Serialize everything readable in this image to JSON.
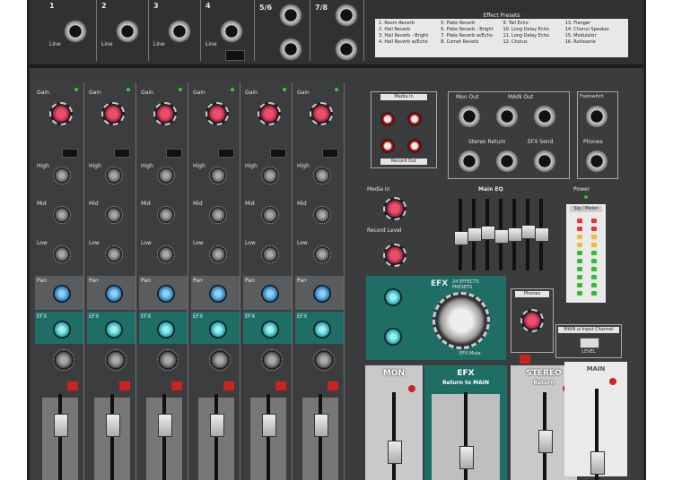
{
  "top": {
    "channel_numbers": [
      "1",
      "2",
      "3",
      "4"
    ],
    "stereo_labels": [
      "5/6",
      "7/8"
    ],
    "line_label": "Line",
    "effect_presets_title": "Effect Presets",
    "effect_presets": [
      "1. Room Reverb",
      "5. Plate Reverb",
      "9. Tail Echo",
      "13. Flanger",
      "2. Hall Reverb",
      "6. Plate Reverb - Bright",
      "10. Long Delay Echo",
      "14. Chorus Speaker",
      "3. Hall Reverb - Bright",
      "7. Plate Reverb w/Echo",
      "11. Long Delay Echo",
      "15. Modulator",
      "4. Hall Reverb w/Echo",
      "8. Comet Reverb",
      "12. Chorus",
      "16. Rotisserie"
    ]
  },
  "channels": {
    "gain_label": "Gain",
    "high_label": "High",
    "mid_label": "Mid",
    "low_label": "Low",
    "pan_label": "Pan",
    "efx_label": "EFX",
    "count": 6
  },
  "io": {
    "media_in": "Media In",
    "record_out": "Record Out",
    "mon_out": "Mon Out",
    "main_out": "MAIN Out",
    "stereo_return": "Stereo Return",
    "efx_send": "EFX Send",
    "footswitch": "Footswitch",
    "phones": "Phones",
    "main_eq": "Main EQ"
  },
  "center": {
    "media_in_label": "Media In",
    "record_level": "Record Level",
    "efx_title": "EFX",
    "efx_sub": "24 EFFECTS PRESETS",
    "efx_to_mon": "EFX Mute",
    "phones_label": "Phones",
    "power_label": "Power",
    "sig_meter": "Sig / Meter",
    "main_switch": "MAIN ⇄ Input Channel",
    "level": "LEVEL"
  },
  "buses": {
    "mon": "MON",
    "efx": "EFX",
    "efx_sub": "Return to MAIN",
    "stereo": "STEREO",
    "stereo_sub": "Return",
    "main": "MAIN"
  },
  "colors": {
    "chassis": "#3a3c3d",
    "gain_knob": "#c8304e",
    "pan_knob": "#2a7fbf",
    "efx_knob": "#23a7b0",
    "efx_panel": "#1f6e66"
  }
}
